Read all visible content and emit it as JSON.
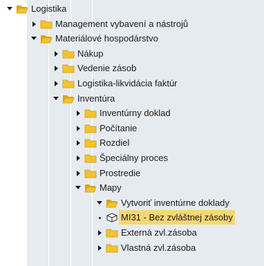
{
  "tree": {
    "nodes": [
      {
        "label": "Logistika",
        "state": "expanded",
        "level": 0,
        "icon": "folder-open-icon"
      },
      {
        "label": "Management vybavení a nástrojů",
        "state": "collapsed",
        "level": 1,
        "icon": "folder-icon"
      },
      {
        "label": "Materiálové hospodárstvo",
        "state": "expanded",
        "level": 1,
        "icon": "folder-open-icon"
      },
      {
        "label": "Nákup",
        "state": "collapsed",
        "level": 2,
        "icon": "folder-icon"
      },
      {
        "label": "Vedenie zásob",
        "state": "collapsed",
        "level": 2,
        "icon": "folder-icon"
      },
      {
        "label": "Logistika-likvidácia faktúr",
        "state": "collapsed",
        "level": 2,
        "icon": "folder-icon"
      },
      {
        "label": "Inventúra",
        "state": "expanded",
        "level": 2,
        "icon": "folder-open-icon"
      },
      {
        "label": "Inventúrny doklad",
        "state": "collapsed",
        "level": 3,
        "icon": "folder-icon"
      },
      {
        "label": "Počítanie",
        "state": "collapsed",
        "level": 3,
        "icon": "folder-icon"
      },
      {
        "label": "Rozdiel",
        "state": "collapsed",
        "level": 3,
        "icon": "folder-icon"
      },
      {
        "label": "Špeciálny proces",
        "state": "collapsed",
        "level": 3,
        "icon": "folder-icon"
      },
      {
        "label": "Prostredie",
        "state": "collapsed",
        "level": 3,
        "icon": "folder-icon"
      },
      {
        "label": "Mapy",
        "state": "expanded",
        "level": 3,
        "icon": "folder-open-icon"
      },
      {
        "label": "Vytvoriť inventúrne doklady",
        "state": "expanded",
        "level": 4,
        "icon": "folder-open-icon"
      },
      {
        "label": "MI31 - Bez zvláštnej zásoby",
        "state": "leaf",
        "level": 5,
        "icon": "transaction-cube-icon",
        "selected": true
      },
      {
        "label": "Externá zvl.zásoba",
        "state": "collapsed",
        "level": 5,
        "icon": "folder-icon"
      },
      {
        "label": "Vlastná zvl.zásoba",
        "state": "collapsed",
        "level": 5,
        "icon": "folder-icon"
      }
    ]
  },
  "colors": {
    "folder": "#f2c230",
    "folder_dark": "#d9a514",
    "band": "#e6ebef",
    "selection": "#f7d774"
  }
}
